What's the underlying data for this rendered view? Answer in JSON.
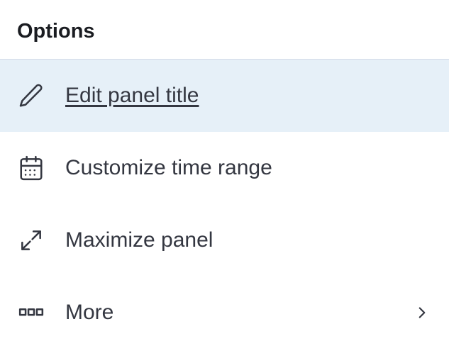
{
  "header": {
    "title": "Options"
  },
  "menu": {
    "items": [
      {
        "label": "Edit panel title",
        "icon": "pencil-icon",
        "highlighted": true
      },
      {
        "label": "Customize time range",
        "icon": "calendar-icon",
        "highlighted": false
      },
      {
        "label": "Maximize panel",
        "icon": "expand-icon",
        "highlighted": false
      },
      {
        "label": "More",
        "icon": "boxes-icon",
        "highlighted": false,
        "hasChevron": true
      }
    ]
  }
}
